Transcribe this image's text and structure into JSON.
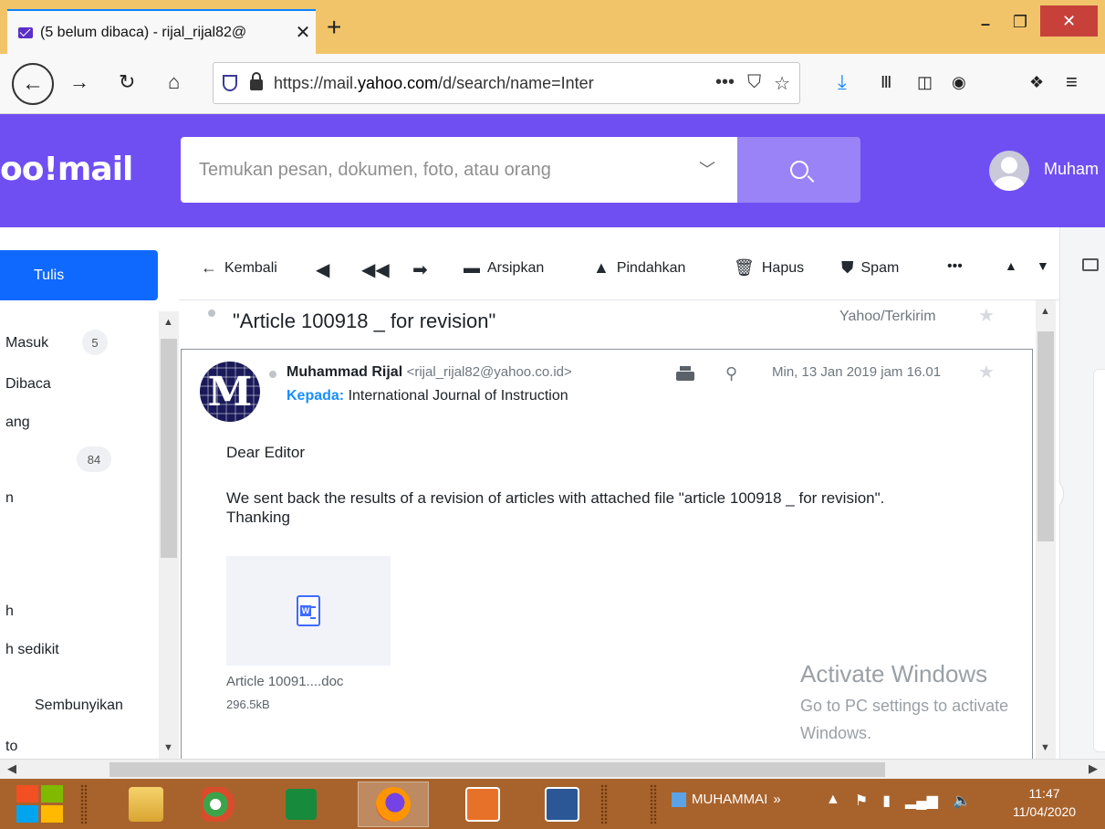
{
  "browser": {
    "tab_title": "(5 belum dibaca) - rijal_rijal82@",
    "tab_close": "✕",
    "new_tab": "+",
    "window_min": "–",
    "window_max": "❐",
    "window_close": "✕",
    "url_prefix": "https://mail.",
    "url_domain": "yahoo.com",
    "url_rest": "/d/search/name=Inter"
  },
  "header": {
    "logo": "oo!mail",
    "search_placeholder": "Temukan pesan, dokumen, foto, atau orang",
    "user_name": "Muham"
  },
  "sidebar": {
    "compose_label": "Tulis",
    "items": [
      {
        "label": "Masuk",
        "badge": "5"
      },
      {
        "label": "Dibaca"
      },
      {
        "label": "ang"
      },
      {
        "label": "",
        "badge": "84"
      },
      {
        "label": "n"
      },
      {
        "label": "h"
      },
      {
        "label": "h sedikit"
      },
      {
        "label": "Sembunyikan"
      },
      {
        "label": "to"
      }
    ]
  },
  "toolbar": {
    "back": "Kembali",
    "archive": "Arsipkan",
    "move": "Pindahkan",
    "delete": "Hapus",
    "spam": "Spam",
    "more": "•••"
  },
  "message": {
    "subject": "\"Article 100918 _ for revision\"",
    "folder": "Yahoo/Terkirim",
    "sender_name": "Muhammad Rijal",
    "sender_email": "<rijal_rijal82@yahoo.co.id>",
    "to_label": "Kepada:",
    "to_value": "International Journal of Instruction",
    "date": "Min, 13 Jan 2019 jam 16.01",
    "greeting": "Dear Editor",
    "body": "We sent back the results of a revision of articles with attached file \"article 100918 _ for revision\". Thanking",
    "attachment_name": "Article 10091....doc",
    "attachment_size": "296.5kB"
  },
  "watermark": {
    "title": "Activate Windows",
    "line1": "Go to PC settings to activate",
    "line2": "Windows."
  },
  "taskbar": {
    "task_label": "MUHAMMAI",
    "task_more": "»",
    "time": "11:47",
    "date": "11/04/2020"
  },
  "colors": {
    "yahoo_purple": "#6f4ff2",
    "compose_blue": "#0f69ff",
    "tabbar": "#f2c46a",
    "taskbar": "#a8632c"
  }
}
